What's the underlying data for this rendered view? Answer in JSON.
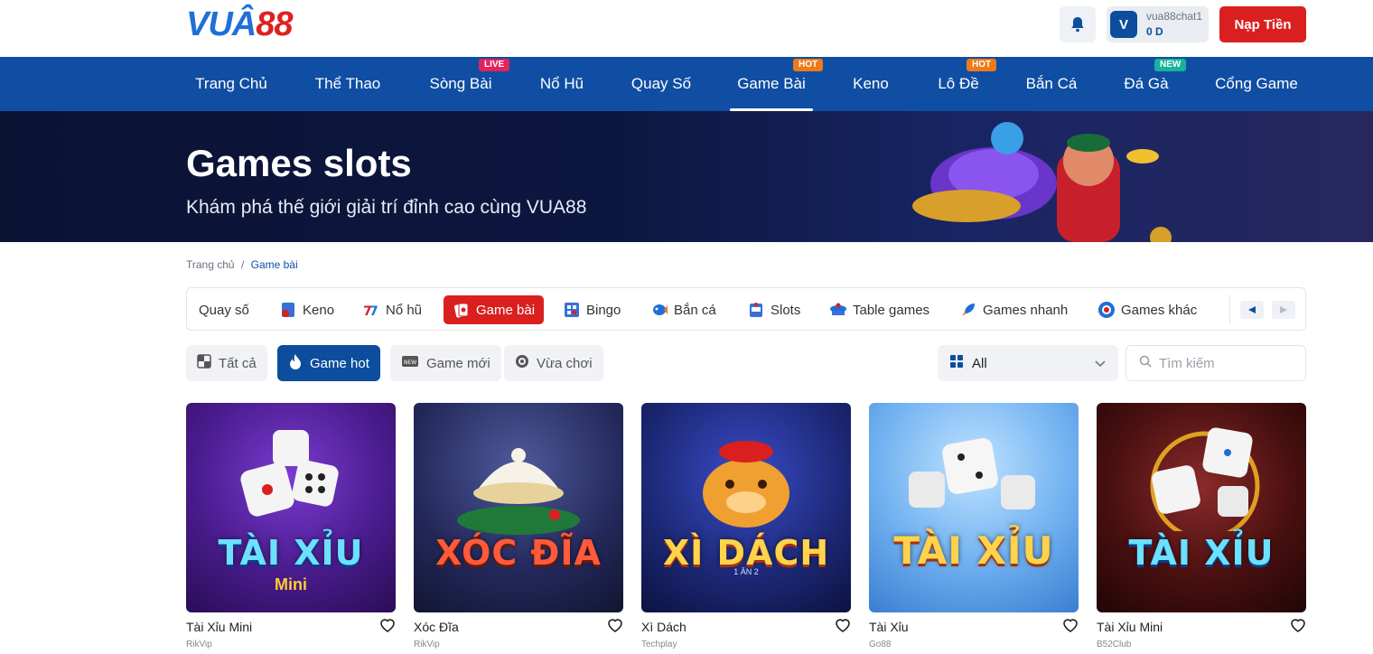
{
  "header": {
    "logo_part1": "VUÂ",
    "logo_part2": "88",
    "username": "vua88chat1",
    "balance": "0 D",
    "avatar_letter": "V",
    "deposit_label": "Nạp Tiền"
  },
  "nav": {
    "items": [
      {
        "label": "Trang Chủ"
      },
      {
        "label": "Thể Thao"
      },
      {
        "label": "Sòng Bài",
        "badge": "LIVE"
      },
      {
        "label": "Nổ Hũ"
      },
      {
        "label": "Quay Số"
      },
      {
        "label": "Game Bài",
        "badge": "HOT"
      },
      {
        "label": "Keno"
      },
      {
        "label": "Lô Đề",
        "badge": "HOT"
      },
      {
        "label": "Bắn Cá"
      },
      {
        "label": "Đá Gà",
        "badge": "NEW"
      },
      {
        "label": "Cổng Game"
      }
    ],
    "active_index": 5
  },
  "banner": {
    "title": "Games slots",
    "subtitle": "Khám phá thế giới giải trí đỉnh cao cùng VUA88"
  },
  "breadcrumb": {
    "home": "Trang chủ",
    "separator": "/",
    "current": "Game bài"
  },
  "categories": {
    "items": [
      {
        "label": "Quay số",
        "icon": "none"
      },
      {
        "label": "Keno",
        "icon": "keno-icon"
      },
      {
        "label": "Nổ hũ",
        "icon": "slot-777-icon"
      },
      {
        "label": "Game bài",
        "icon": "cards-icon"
      },
      {
        "label": "Bingo",
        "icon": "bingo-icon"
      },
      {
        "label": "Bắn cá",
        "icon": "fish-icon"
      },
      {
        "label": "Slots",
        "icon": "slot-machine-icon"
      },
      {
        "label": "Table games",
        "icon": "table-icon"
      },
      {
        "label": "Games nhanh",
        "icon": "rocket-icon"
      },
      {
        "label": "Games khác",
        "icon": "chip-icon"
      }
    ],
    "active_index": 3
  },
  "filters": {
    "items": [
      {
        "label": "Tất cả",
        "icon": "grid-icon"
      },
      {
        "label": "Game hot",
        "icon": "flame-icon"
      },
      {
        "label": "Game mới",
        "icon": "new-icon"
      },
      {
        "label": "Vừa chơi",
        "icon": "clock-icon"
      }
    ],
    "active_index": 1,
    "select_value": "All",
    "search_placeholder": "Tìm kiếm"
  },
  "games": [
    {
      "name": "Tài Xỉu Mini",
      "provider": "RikVip",
      "thumb_text": "TÀI XỈU",
      "thumb_sub": "Mini"
    },
    {
      "name": "Xóc Đĩa",
      "provider": "RikVip",
      "thumb_text": "XÓC ĐĨA",
      "thumb_sub": ""
    },
    {
      "name": "Xì Dách",
      "provider": "Techplay",
      "thumb_text": "XÌ DÁCH",
      "thumb_sub": "1 ĂN 2"
    },
    {
      "name": "Tài Xỉu",
      "provider": "Go88",
      "thumb_text": "TÀI XỈU",
      "thumb_sub": ""
    },
    {
      "name": "Tài Xỉu Mini",
      "provider": "B52Club",
      "thumb_text": "TÀI XỈU",
      "thumb_sub": ""
    }
  ],
  "colors": {
    "primary": "#0f4ea3",
    "accent_red": "#d9201f",
    "badge_live": "#e3245a",
    "badge_hot": "#f07a18",
    "badge_new": "#17b39a"
  }
}
